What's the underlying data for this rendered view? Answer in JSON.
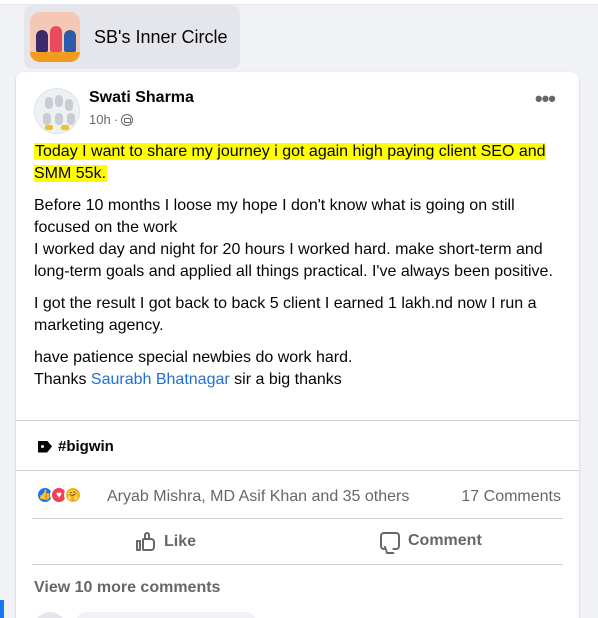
{
  "group": {
    "name": "SB's Inner Circle"
  },
  "post": {
    "author": "Swati Sharma",
    "time": "10h",
    "separator": "·",
    "more_label": "•••",
    "highlight_text": "Today I want to share my journey i got again high paying client SEO and SMM 55k.",
    "paragraph1": "Before  10 months I loose my hope I don't know what is going on still focused on the work\nI worked day and night for 20 hours I worked hard. make short-term and long-term goals and applied all things practical. I've always been positive.",
    "paragraph2": "I got the result I got back to back 5 client I earned 1 lakh.nd now I run a marketing agency.",
    "paragraph3_line1": "have patience special newbies do work hard.",
    "paragraph3_prefix": "Thanks ",
    "mention": "Saurabh Bhatnagar",
    "paragraph3_suffix": " sir a big thanks",
    "hashtag": "#bigwin",
    "reactions_text": "Aryab Mishra, MD Asif Khan and 35 others",
    "comments_count": "17 Comments",
    "like_label": "Like",
    "comment_label": "Comment",
    "view_more": "View 10 more comments"
  },
  "colors": {
    "highlight": "#ffff00",
    "link": "#216fdb",
    "like": "#1877f2",
    "love": "#f33e58",
    "care": "#f7b125"
  }
}
